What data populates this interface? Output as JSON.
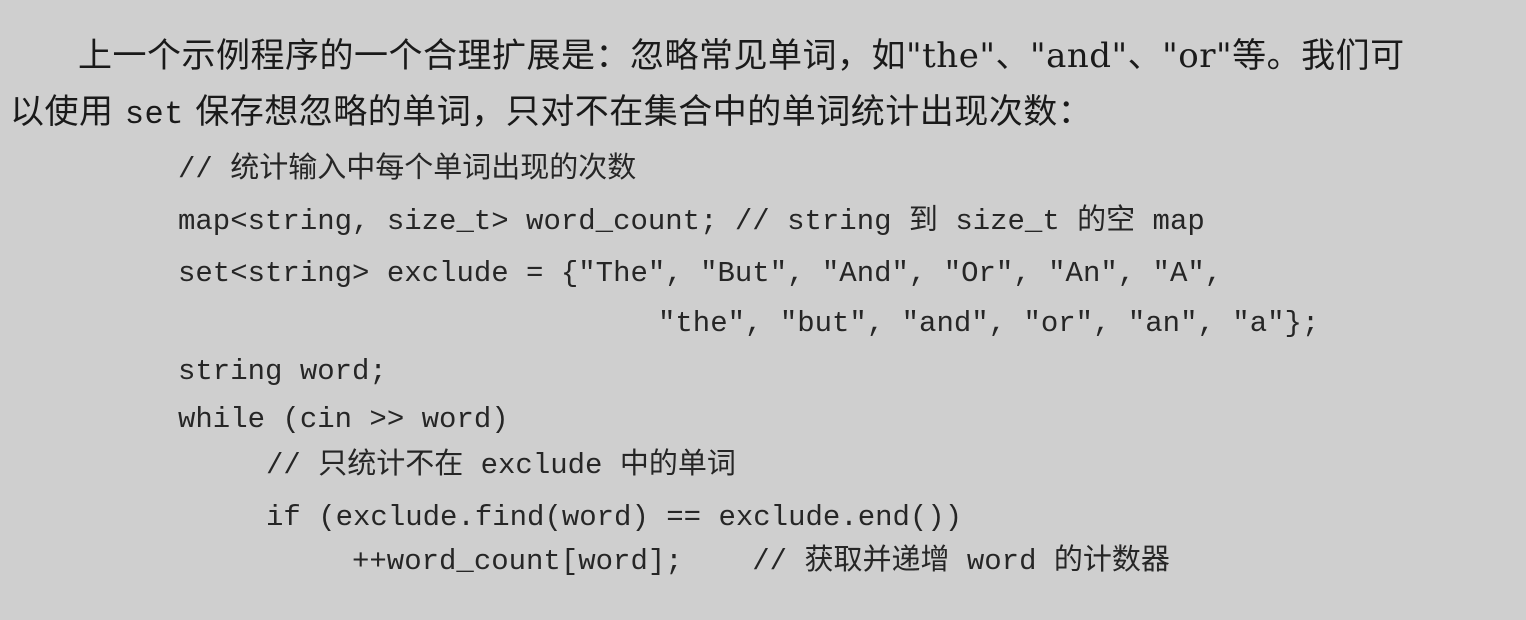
{
  "paragraph": {
    "line1": "上一个示例程序的一个合理扩展是：忽略常见单词，如\"the\"、\"and\"、\"or\"等。我们可",
    "line2_pre": "以使用 ",
    "line2_code": "set",
    "line2_post": " 保存想忽略的单词，只对不在集合中的单词统计出现次数："
  },
  "code": {
    "l1": "// 统计输入中每个单词出现的次数",
    "l2": "map<string, size_t> word_count; // string 到 size_t 的空 map",
    "l3": "set<string> exclude = {\"The\", \"But\", \"And\", \"Or\", \"An\", \"A\",",
    "l4": "\"the\", \"but\", \"and\", \"or\", \"an\", \"a\"};",
    "l5": "string word;",
    "l6": "while (cin >> word)",
    "l7": "// 只统计不在 exclude 中的单词",
    "l8": "if (exclude.find(word) == exclude.end())",
    "l9": "++word_count[word];    // 获取并递增 word 的计数器"
  }
}
